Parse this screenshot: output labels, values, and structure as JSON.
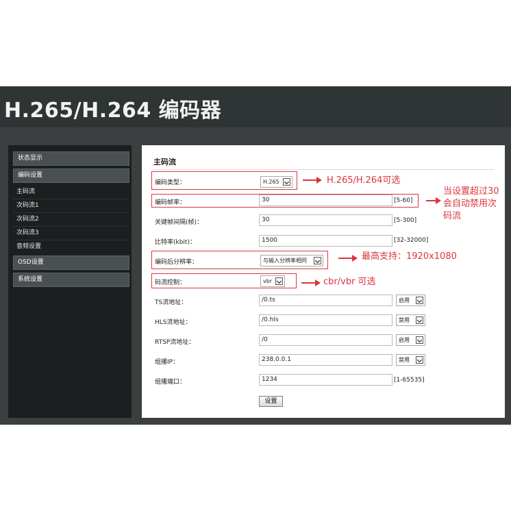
{
  "header": {
    "title": "H.265/H.264 编码器"
  },
  "sidebar": {
    "status": "状态显示",
    "encode_settings": "编码设置",
    "items": [
      "主码流",
      "次码流1",
      "次码流2",
      "次码流3",
      "音频设置"
    ],
    "osd": "OSD设置",
    "system": "系统设置"
  },
  "main": {
    "section_title": "主码流",
    "rows": {
      "codec_type": {
        "label": "编码类型：",
        "value": "H.265"
      },
      "frame_rate": {
        "label": "编码帧率：",
        "value": "30",
        "range": "[5-60]"
      },
      "keyframe_interval": {
        "label": "关键帧间隔(帧)：",
        "value": "30",
        "range": "[5-300]"
      },
      "bitrate": {
        "label": "比特率(kbit)：",
        "value": "1500",
        "range": "[32-32000]"
      },
      "resolution": {
        "label": "编码后分辨率：",
        "value": "与输入分辨率相同"
      },
      "rate_control": {
        "label": "码流控制：",
        "value": "vbr"
      },
      "ts_url": {
        "label": "TS流地址：",
        "value": "/0.ts",
        "toggle": "启用"
      },
      "hls_url": {
        "label": "HLS流地址：",
        "value": "/0.hls",
        "toggle": "禁用"
      },
      "rtsp_url": {
        "label": "RTSP流地址：",
        "value": "/0",
        "toggle": "启用"
      },
      "multicast_ip": {
        "label": "组播IP：",
        "value": "238.0.0.1",
        "toggle": "禁用"
      },
      "multicast_port": {
        "label": "组播端口：",
        "value": "1234",
        "range": "[1-65535]"
      }
    },
    "submit_label": "设置"
  },
  "annotations": {
    "codec": "H.265/H.264可选",
    "framerate_line1": "当设置超过30",
    "framerate_line2": "会自动禁用次",
    "framerate_line3": "码流",
    "resolution": "最高支持：1920x1080",
    "rate_control": "cbr/vbr 可选"
  },
  "colors": {
    "header_bg": "#2f3435",
    "sidebar_bg": "#1c1f20",
    "annotation_red": "#d9363e"
  }
}
